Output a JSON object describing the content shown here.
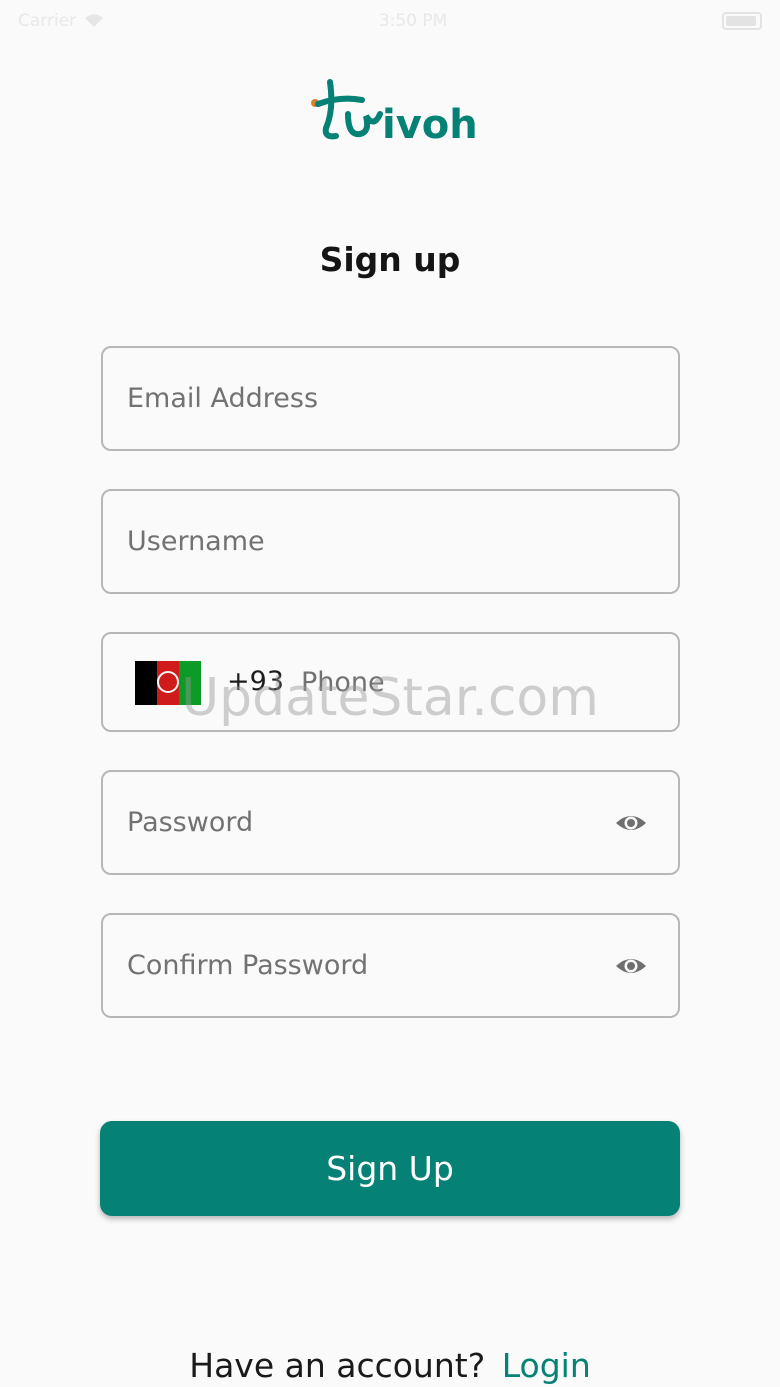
{
  "status_bar": {
    "carrier": "Carrier",
    "time": "3:50 PM"
  },
  "brand": {
    "logo_text": "trivoh",
    "logo_color": "#068176",
    "accent_dot_color": "#d9822b"
  },
  "page": {
    "title": "Sign up"
  },
  "form": {
    "email_placeholder": "Email Address",
    "username_placeholder": "Username",
    "phone": {
      "country_flag": "afghanistan-flag-icon",
      "dial_code": "+93",
      "placeholder": "Phone"
    },
    "password_placeholder": "Password",
    "confirm_password_placeholder": "Confirm Password",
    "visibility_icon": "eye-icon"
  },
  "watermark": "UpdateStar.com",
  "actions": {
    "signup_label": "Sign Up",
    "primary_color": "#068176"
  },
  "footer": {
    "prompt": "Have an account?",
    "login_link": "Login"
  }
}
